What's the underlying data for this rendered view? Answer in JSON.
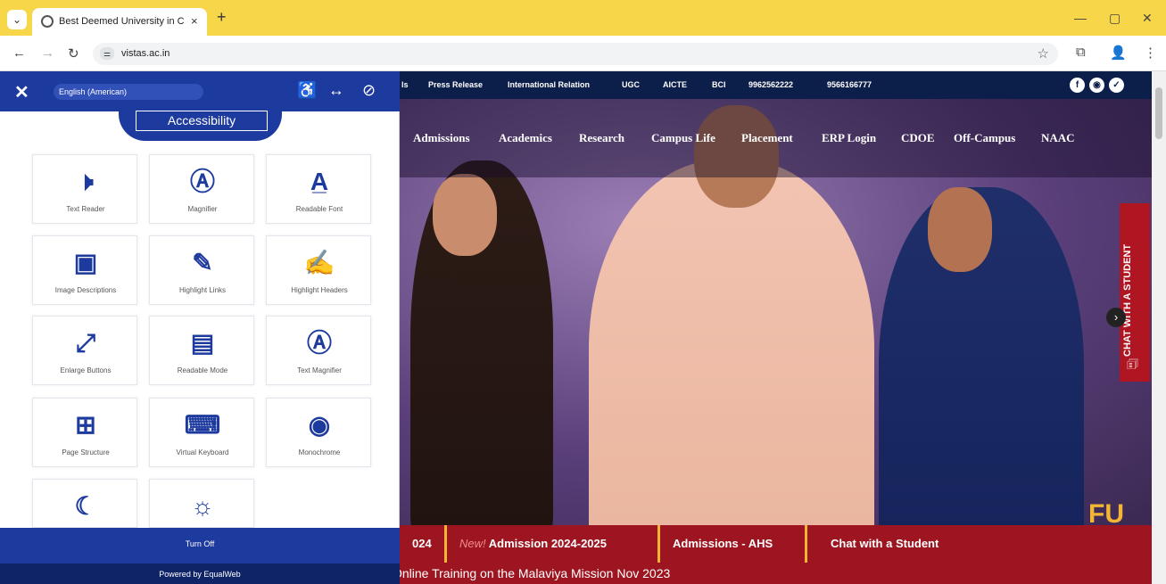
{
  "browser": {
    "tab_title": "Best Deemed University in Che",
    "tab_close": "×",
    "new_tab": "+",
    "tab_menu_icon": "⌄",
    "url": "vistas.ac.in",
    "back": "←",
    "forward": "→",
    "reload": "↻",
    "site_info": "⚌",
    "bookmark": "☆",
    "extensions": "⧉",
    "profile": "👤",
    "menu": "⋮",
    "minimize": "—",
    "restore": "▢",
    "close": "✕"
  },
  "site": {
    "topbar": [
      "ls",
      "Press Release",
      "International Relation",
      "UGC",
      "AICTE",
      "BCI",
      "9962562222",
      "9566166777"
    ],
    "social": [
      "f",
      "◉",
      "✓"
    ],
    "nav": [
      "Admissions",
      "Academics",
      "Research",
      "Campus Life",
      "Placement",
      "ERP Login",
      "CDOE",
      "Off-Campus",
      "NAAC"
    ],
    "chat_side": "CHAT WITH A STUDENT",
    "chat_icon": "🗊",
    "next_arrow": "›",
    "ticker": {
      "partial": "024",
      "new_label": "New!",
      "admission": "Admission 2024-2025",
      "ahs": "Admissions - AHS",
      "chat": "Chat with a Student"
    },
    "marquee": "Online Training on the Malaviya Mission Nov 2023",
    "deco": "FU"
  },
  "accessibility": {
    "close_icon": "✕",
    "language": "English (American)",
    "title": "Accessibility",
    "header_icons": [
      "♿",
      "↔",
      "⊘"
    ],
    "tiles": [
      {
        "label": "Text Reader",
        "icon": "🕨"
      },
      {
        "label": "Magnifier",
        "icon": "Ⓐ"
      },
      {
        "label": "Readable Font",
        "icon": "A̲"
      },
      {
        "label": "Image Descriptions",
        "icon": "▣"
      },
      {
        "label": "Highlight Links",
        "icon": "✎"
      },
      {
        "label": "Highlight Headers",
        "icon": "✍"
      },
      {
        "label": "Enlarge Buttons",
        "icon": "⤢"
      },
      {
        "label": "Readable Mode",
        "icon": "▤"
      },
      {
        "label": "Text Magnifier",
        "icon": "Ⓐ"
      },
      {
        "label": "Page Structure",
        "icon": "⊞"
      },
      {
        "label": "Virtual Keyboard",
        "icon": "⌨"
      },
      {
        "label": "Monochrome",
        "icon": "◉"
      },
      {
        "label": "",
        "icon": "☾"
      },
      {
        "label": "",
        "icon": "☼"
      }
    ],
    "turn_off": "Turn Off",
    "powered_by": "Powered by EqualWeb"
  }
}
